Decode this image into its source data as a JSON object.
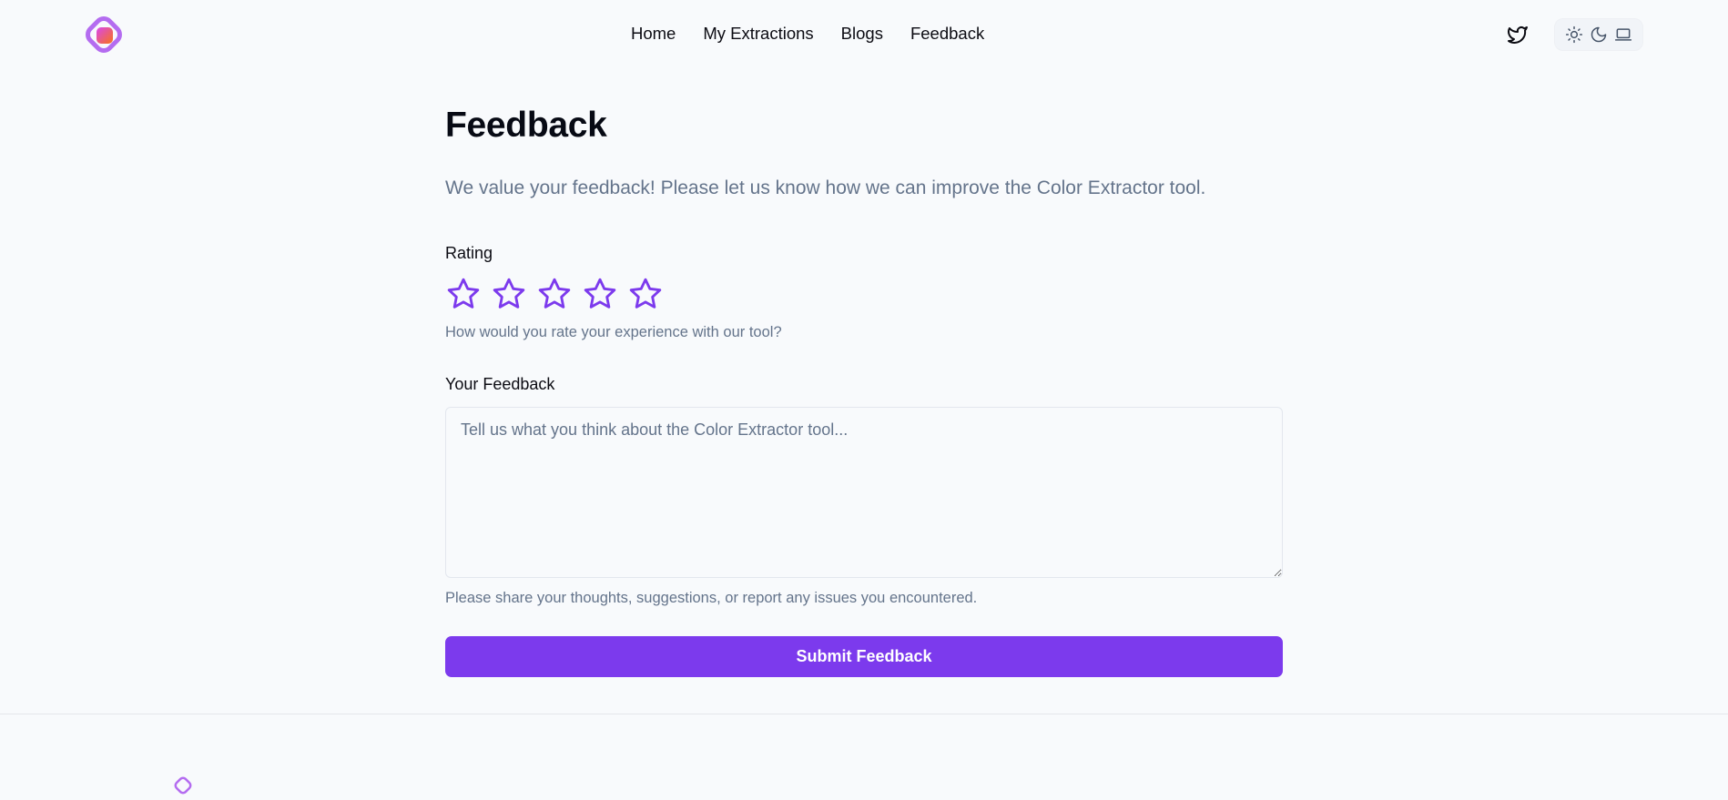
{
  "nav": {
    "items": [
      {
        "label": "Home"
      },
      {
        "label": "My Extractions"
      },
      {
        "label": "Blogs"
      },
      {
        "label": "Feedback"
      }
    ]
  },
  "header_icons": {
    "twitter": "twitter-icon",
    "theme": [
      "sun-icon",
      "moon-icon",
      "laptop-icon"
    ]
  },
  "page": {
    "title": "Feedback",
    "subtitle": "We value your feedback! Please let us know how we can improve the Color Extractor tool."
  },
  "rating": {
    "label": "Rating",
    "max_stars": 5,
    "selected": 0,
    "help": "How would you rate your experience with our tool?"
  },
  "feedback": {
    "label": "Your Feedback",
    "placeholder": "Tell us what you think about the Color Extractor tool...",
    "value": "",
    "help": "Please share your thoughts, suggestions, or report any issues you encountered."
  },
  "submit": {
    "label": "Submit Feedback"
  },
  "colors": {
    "accent": "#7c3aed",
    "muted_text": "#64748b",
    "background": "#f8fafc"
  }
}
